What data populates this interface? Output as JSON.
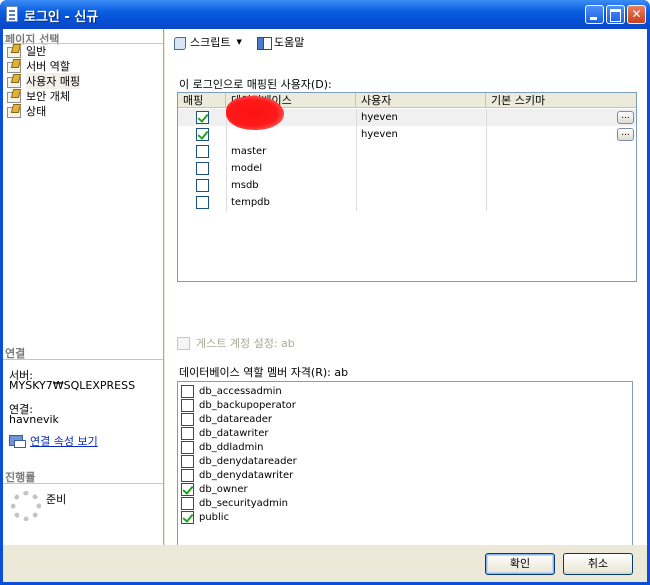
{
  "window": {
    "title": "로그인 - 신규"
  },
  "left": {
    "page_select_header": "페이지 선택",
    "nav_items": [
      {
        "label": "일반"
      },
      {
        "label": "서버 역할"
      },
      {
        "label": "사용자 매핑"
      },
      {
        "label": "보안 개체"
      },
      {
        "label": "상태"
      }
    ],
    "connection_header": "연결",
    "server_label": "서버:",
    "server_value": "MYSKY7₩SQLEXPRESS",
    "connection_label": "연결:",
    "connection_value": "havnevik",
    "view_conn_props": "연결 속성 보기",
    "progress_header": "진행률",
    "progress_status": "준비"
  },
  "toolbar": {
    "script_label": "스크립트",
    "help_label": "도움말"
  },
  "mapping": {
    "label": "이 로그인으로 매핑된 사용자(D):",
    "columns": [
      "매핑",
      "데이터베이스",
      "사용자",
      "기본 스키마"
    ],
    "rows": [
      {
        "checked": true,
        "database": "",
        "user": "hyeven",
        "schema": ""
      },
      {
        "checked": true,
        "database": "",
        "user": "hyeven",
        "schema": ""
      },
      {
        "checked": false,
        "database": "master",
        "user": "",
        "schema": ""
      },
      {
        "checked": false,
        "database": "model",
        "user": "",
        "schema": ""
      },
      {
        "checked": false,
        "database": "msdb",
        "user": "",
        "schema": ""
      },
      {
        "checked": false,
        "database": "tempdb",
        "user": "",
        "schema": ""
      }
    ],
    "ellipsis": "..."
  },
  "guest": {
    "label": "게스트 계정 설정: ab"
  },
  "roles": {
    "label": "데이터베이스 역할 멤버 자격(R): ab",
    "items": [
      {
        "name": "db_accessadmin",
        "checked": false
      },
      {
        "name": "db_backupoperator",
        "checked": false
      },
      {
        "name": "db_datareader",
        "checked": false
      },
      {
        "name": "db_datawriter",
        "checked": false
      },
      {
        "name": "db_ddladmin",
        "checked": false
      },
      {
        "name": "db_denydatareader",
        "checked": false
      },
      {
        "name": "db_denydatawriter",
        "checked": false
      },
      {
        "name": "db_owner",
        "checked": true
      },
      {
        "name": "db_securityadmin",
        "checked": false
      },
      {
        "name": "public",
        "checked": true
      }
    ]
  },
  "buttons": {
    "ok": "확인",
    "cancel": "취소"
  }
}
